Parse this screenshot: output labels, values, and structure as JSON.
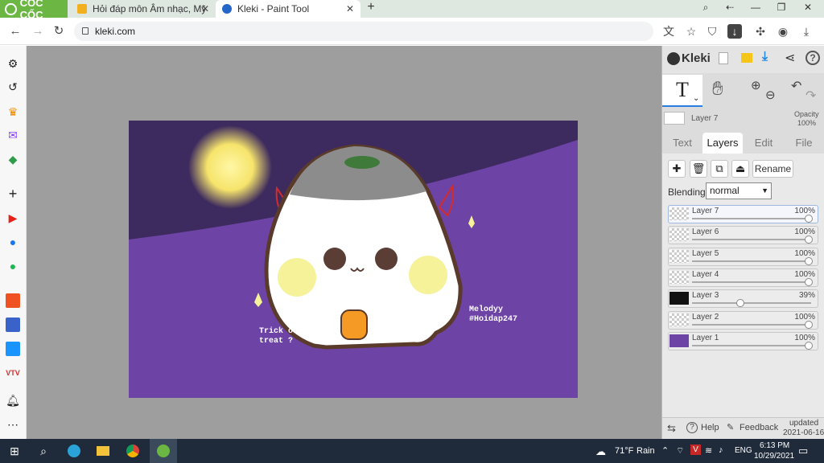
{
  "browser": {
    "brand": "CỐC CỐC",
    "tabs": [
      {
        "title": "Hỏi đáp môn Âm nhạc, Mỹ th",
        "favicon_color": "#f2b01e"
      },
      {
        "title": "Kleki - Paint Tool",
        "favicon_color": "#2467c9"
      }
    ],
    "new_tab": "+",
    "url": "kleki.com"
  },
  "artwork": {
    "bg_top_color": "#3d2a5e",
    "bg_bottom_color": "#6d43a6",
    "moon_color": "#f6e46b",
    "text_left_line1": "Trick or",
    "text_left_line2": "treat ?",
    "text_right_line1": "Melodyy",
    "text_right_line2": "#Hoidap247"
  },
  "kleki": {
    "brand": "Kleki",
    "tool_letter": "T",
    "current_layer": "Layer 7",
    "opacity_label": "Opacity",
    "opacity_value": "100%",
    "tabs": [
      "Text",
      "Layers",
      "Edit",
      "File"
    ],
    "rename": "Rename",
    "blending_label": "Blending",
    "blending_value": "normal",
    "layers": [
      {
        "name": "Layer 7",
        "opacity": "100%",
        "value": 1.0
      },
      {
        "name": "Layer 6",
        "opacity": "100%",
        "value": 1.0
      },
      {
        "name": "Layer 5",
        "opacity": "100%",
        "value": 1.0
      },
      {
        "name": "Layer 4",
        "opacity": "100%",
        "value": 1.0
      },
      {
        "name": "Layer 3",
        "opacity": "39%",
        "value": 0.39
      },
      {
        "name": "Layer 2",
        "opacity": "100%",
        "value": 1.0
      },
      {
        "name": "Layer 1",
        "opacity": "100%",
        "value": 1.0
      }
    ],
    "help": "Help",
    "feedback": "Feedback",
    "updated_line1": "updated",
    "updated_line2": "2021-06-16"
  },
  "taskbar": {
    "weather_temp": "71°F",
    "weather_desc": "Rain",
    "lang": "ENG",
    "time": "6:13 PM",
    "date": "10/29/2021"
  }
}
